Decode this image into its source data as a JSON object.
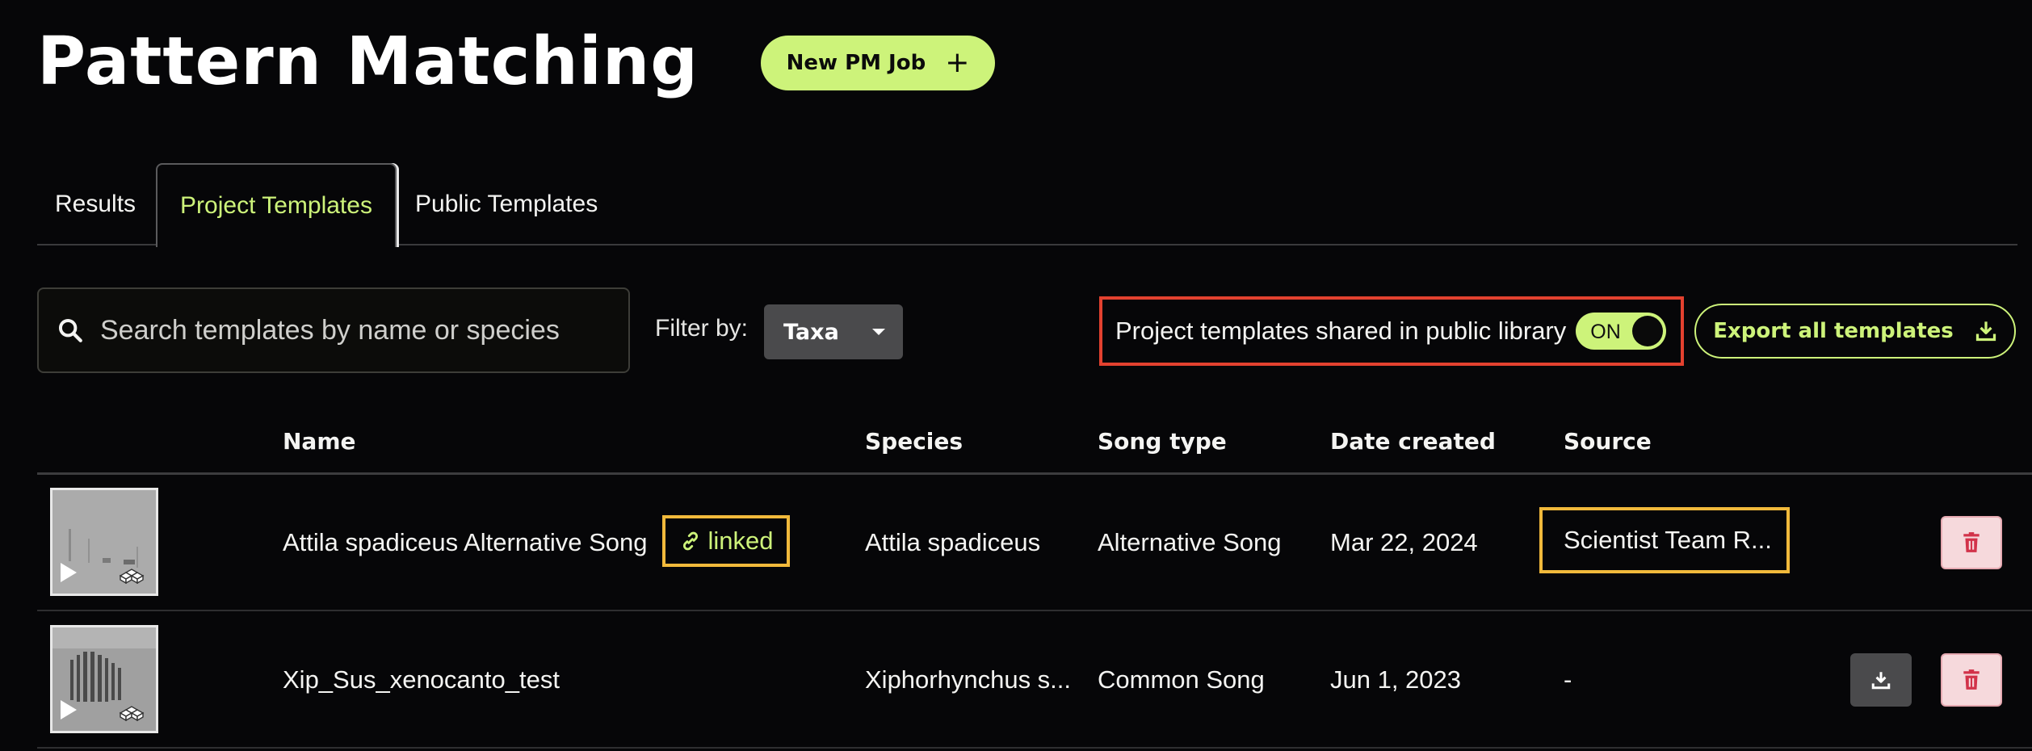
{
  "header": {
    "title": "Pattern Matching",
    "new_job_label": "New PM Job",
    "new_job_icon": "+"
  },
  "tabs": [
    {
      "label": "Results",
      "active": false
    },
    {
      "label": "Project Templates",
      "active": true
    },
    {
      "label": "Public Templates",
      "active": false
    }
  ],
  "filters": {
    "search_placeholder": "Search templates by name or species",
    "search_value": "",
    "filter_label": "Filter by:",
    "filter_value": "Taxa",
    "share_label": "Project templates shared in public library",
    "share_toggle": "ON",
    "export_label": "Export all templates"
  },
  "table": {
    "headers": [
      "Name",
      "Species",
      "Song type",
      "Date created",
      "Source"
    ],
    "rows": [
      {
        "name": "Attila spadiceus Alternative Song",
        "linked_label": "linked",
        "species": "Attila spadiceus",
        "song_type": "Alternative Song",
        "date": "Mar 22, 2024",
        "source": "Scientist Team R..."
      },
      {
        "name": "Xip_Sus_xenocanto_test",
        "species": "Xiphorhynchus s...",
        "song_type": "Common Song",
        "date": "Jun 1, 2023",
        "source": "-"
      }
    ]
  },
  "colors": {
    "background": "#060608",
    "accent": "#cdf37a",
    "highlight_red": "#e3412f",
    "highlight_yellow": "#f1b93b",
    "delete_bg": "#f6d9dc",
    "delete_icon": "#d2334a"
  },
  "icons": {
    "search": "search-icon",
    "caret": "chevron-down-icon",
    "export": "download-icon",
    "link": "link-icon",
    "play": "play-icon",
    "cubes": "cubes-icon",
    "trash": "trash-icon"
  }
}
